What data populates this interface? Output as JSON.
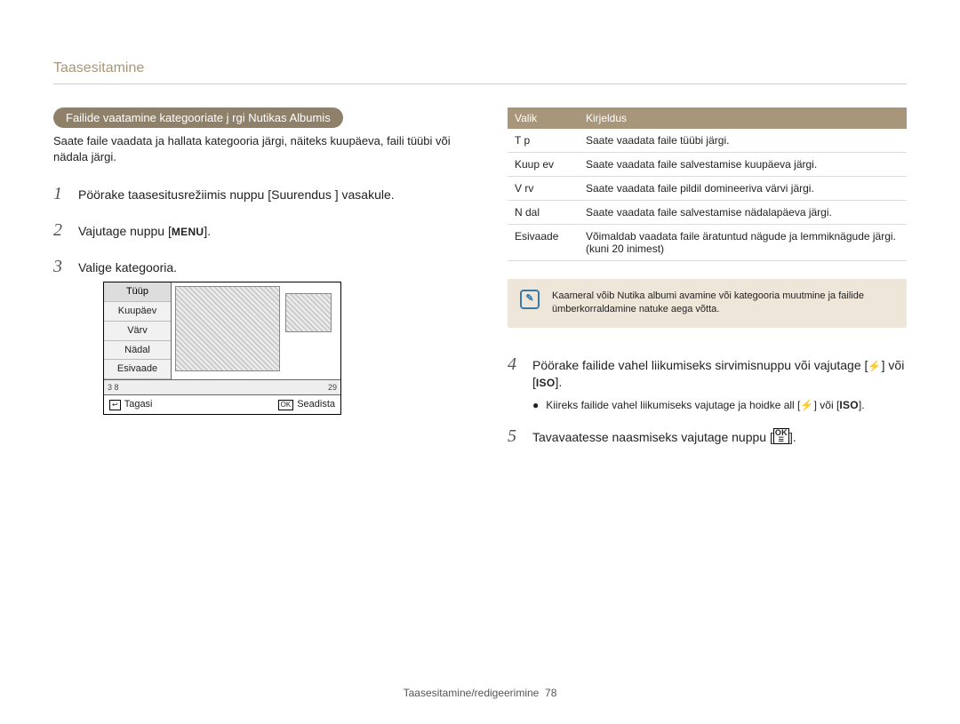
{
  "header": {
    "title": "Taasesitamine"
  },
  "left": {
    "pill": "Failide vaatamine kategooriate j rgi Nutikas Albumis",
    "intro": "Saate faile vaadata ja hallata kategooria järgi, näiteks kuupäeva, faili tüübi või nädala järgi.",
    "step1": "Pöörake taasesitusrežiimis nuppu [Suurendus ] vasakule.",
    "step2_pre": "Vajutage nuppu [",
    "step2_glyph": "MENU",
    "step2_post": "].",
    "step3": "Valige kategooria.",
    "mock": {
      "menu": [
        "Tüüp",
        "Kuupäev",
        "Värv",
        "Nädal",
        "Esivaade"
      ],
      "bar_left": "3   8",
      "bar_right": "29",
      "foot_back_key": "↩",
      "foot_back": "Tagasi",
      "foot_set_key": "OK",
      "foot_set": "Seadista"
    }
  },
  "right": {
    "table": {
      "head": {
        "k": "Valik",
        "v": "Kirjeldus"
      },
      "rows": [
        {
          "k": "T  p",
          "v": "Saate vaadata faile tüübi järgi."
        },
        {
          "k": "Kuup ev",
          "v": "Saate vaadata faile salvestamise kuupäeva järgi."
        },
        {
          "k": "V rv",
          "v": "Saate vaadata faile pildil domineeriva värvi järgi."
        },
        {
          "k": "N dal",
          "v": "Saate vaadata faile salvestamise nädalapäeva järgi."
        },
        {
          "k": "Esivaade",
          "v": "Võimaldab vaadata faile äratuntud nägude ja lemmiknägude järgi. (kuni 20 inimest)"
        }
      ]
    },
    "note": "Kaameral võib Nutika albumi avamine või kategooria muutmine ja failide ümberkorraldamine natuke aega võtta.",
    "step4_pre": "Pöörake failide vahel liikumiseks sirvimisnuppu või vajutage [",
    "step4_glyph1": "⚡",
    "step4_mid": "] või [",
    "step4_glyph2": "ISO",
    "step4_post": "].",
    "step4_bullet_pre": "Kiireks failide vahel liikumiseks vajutage ja hoidke all [",
    "step4_bullet_mid": "] või [",
    "step4_bullet_post": "].",
    "step5_pre": "Tavavaatesse naasmiseks vajutage nuppu [",
    "step5_post": "]."
  },
  "footer": {
    "text": "Taasesitamine/redigeerimine",
    "page": "78"
  }
}
